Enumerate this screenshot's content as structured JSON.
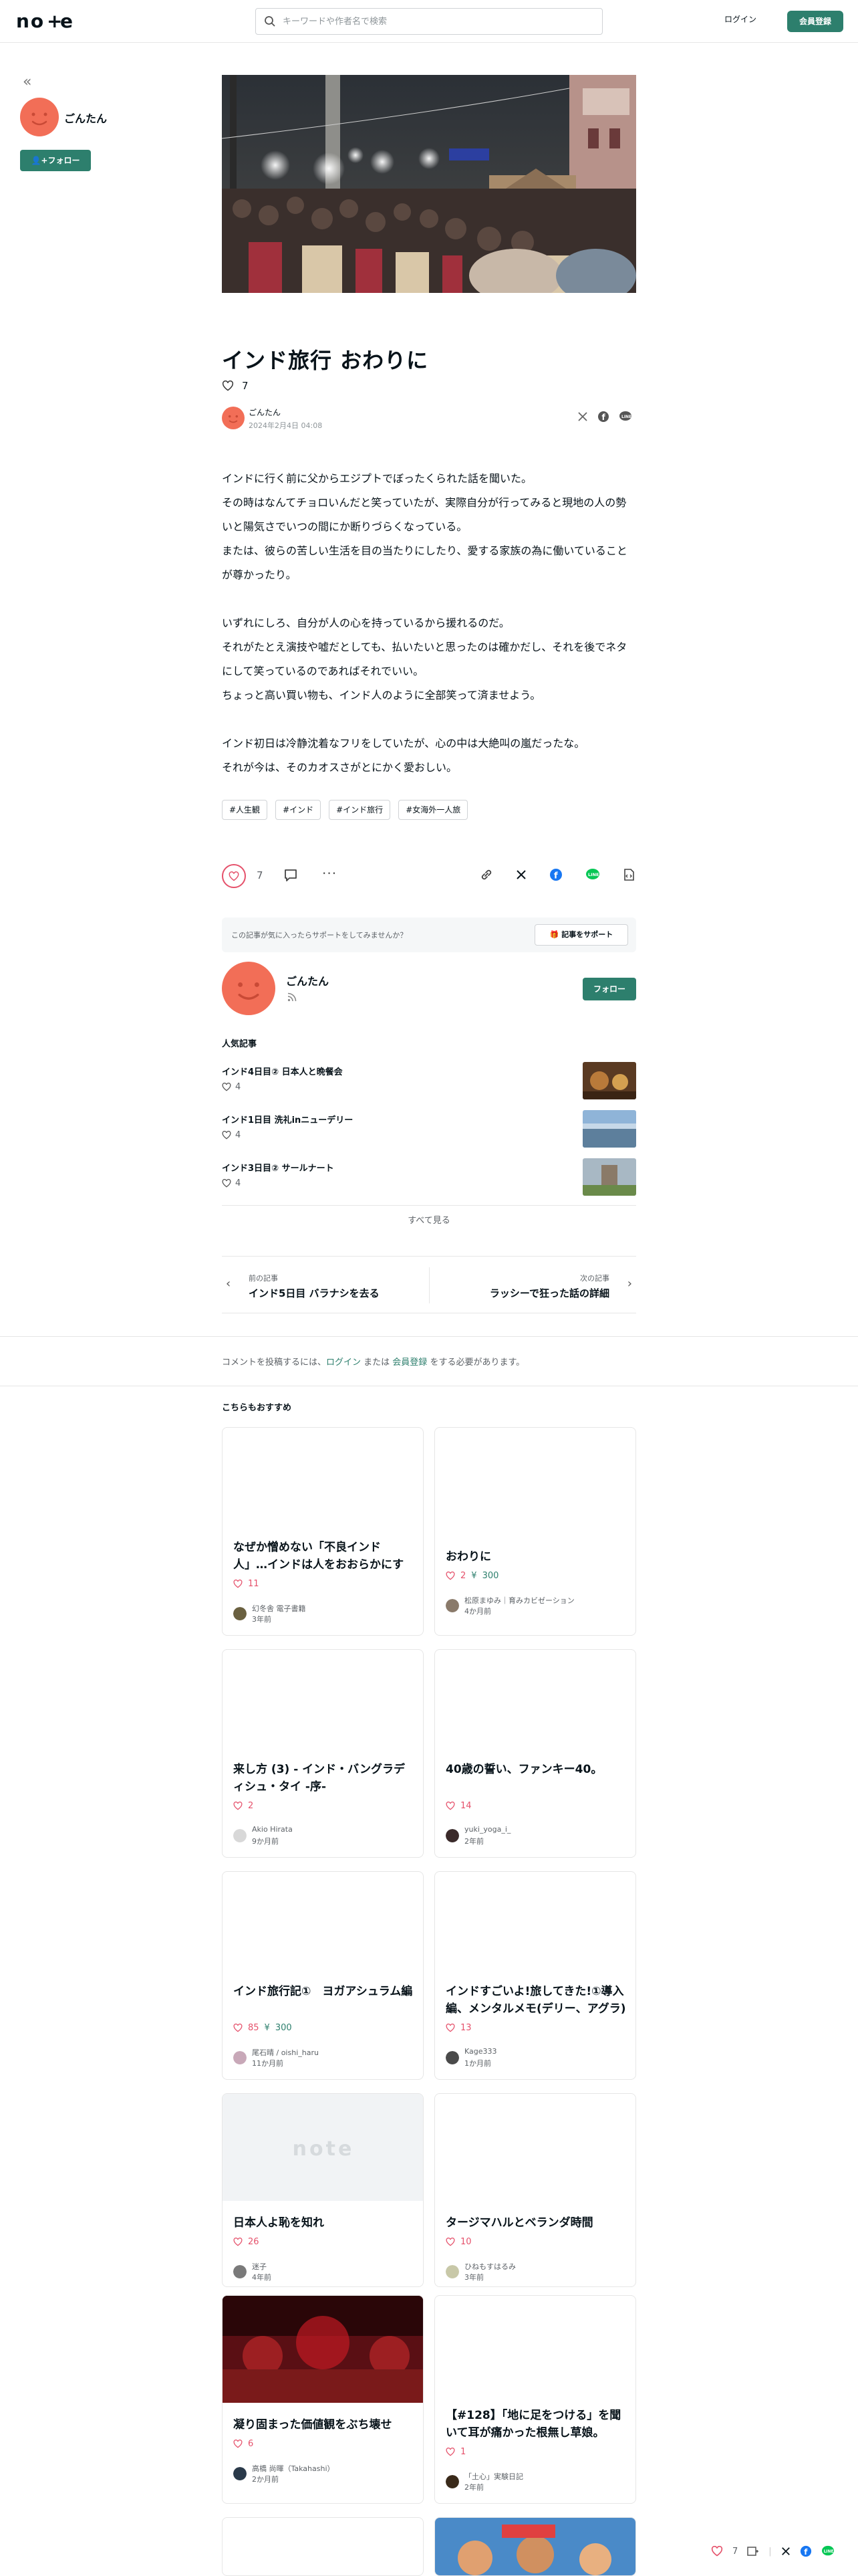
{
  "header": {
    "search_placeholder": "キーワードや作者名で検索",
    "login": "ログイン",
    "signup": "会員登録"
  },
  "sidebar": {
    "author_name": "ごんたん",
    "follow": "フォロー"
  },
  "article": {
    "title": "インド旅行 おわりに",
    "likes": "7",
    "author": "ごんたん",
    "date": "2024年2月4日 04:08",
    "paragraphs": [
      "インドに行く前に父からエジプトでぼったくられた話を聞いた。\nその時はなんてチョロいんだと笑っていたが、実際自分が行ってみると現地の人の勢いと陽気さでいつの間にか断りづらくなっている。\nまたは、彼らの苦しい生活を目の当たりにしたり、愛する家族の為に働いていることが尊かったり。",
      "いずれにしろ、自分が人の心を持っているから援れるのだ。\nそれがたとえ演技や嘘だとしても、払いたいと思ったのは確かだし、それを後でネタにして笑っているのであればそれでいい。\nちょっと高い買い物も、インド人のように全部笑って済ませよう。",
      "インド初日は冷静沈着なフリをしていたが、心の中は大絶叫の嵐だったな。\nそれが今は、そのカオスさがとにかく愛おしい。"
    ],
    "tags": [
      "#人生観",
      "#インド",
      "#インド旅行",
      "#女海外一人旅"
    ],
    "like_count": "7"
  },
  "support": {
    "text": "この記事が気に入ったらサポートをしてみませんか？",
    "button": "記事をサポート"
  },
  "creator_card": {
    "name": "ごんたん",
    "follow": "フォロー"
  },
  "popular": {
    "heading": "人気記事",
    "items": [
      {
        "title": "インド4日目② 日本人と晩餐会",
        "likes": "4"
      },
      {
        "title": "インド1日目 洗礼inニューデリー",
        "likes": "4"
      },
      {
        "title": "インド3日目② サールナート",
        "likes": "4"
      }
    ],
    "see_all": "すべて見る"
  },
  "prev_next": {
    "prev_label": "前の記事",
    "prev_title": "インド5日目 バラナシを去る",
    "next_label": "次の記事",
    "next_title": "ラッシーで狂った話の詳細"
  },
  "comment": {
    "prefix": "コメントを投稿するには、",
    "login": "ログイン",
    "middle": " または ",
    "signup": "会員登録",
    "suffix": " をする必要があります。"
  },
  "recommend": {
    "heading": "こちらもおすすめ",
    "cards": [
      {
        "title": "なぜか憎めない「不良インド人」…インドは人をおおらかにする",
        "likes": "11",
        "tips": "",
        "author": "幻冬舎 電子書籍",
        "date": "3年前"
      },
      {
        "title": "おわりに",
        "likes": "2",
        "tips": "300",
        "author": "松原まゆみ｜育みカビゼーション",
        "date": "4か月前"
      },
      {
        "title": "来し方 (3) - インド・バングラディシュ・タイ -序-",
        "likes": "2",
        "tips": "",
        "author": "Akio Hirata",
        "date": "9か月前"
      },
      {
        "title": "40歳の誓い、ファンキー40。",
        "likes": "14",
        "tips": "",
        "author": "yuki_yoga_i_",
        "date": "2年前"
      },
      {
        "title": "インド旅行記①　ヨガアシュラム編",
        "likes": "85",
        "tips": "300",
        "author": "尾石晴 / oishi_haru",
        "date": "11か月前"
      },
      {
        "title": "インドすごいよ!旅してきた!①導入編、メンタルメモ(デリー、アグラ)",
        "likes": "13",
        "tips": "",
        "author": "Kage333",
        "date": "1か月前"
      },
      {
        "title": "日本人よ恥を知れ",
        "likes": "26",
        "tips": "",
        "author": "迷子",
        "date": "4年前"
      },
      {
        "title": "タージマハルとベランダ時間",
        "likes": "10",
        "tips": "",
        "author": "ひねもすはるみ",
        "date": "3年前"
      },
      {
        "title": "凝り固まった価値観をぶち壊せ",
        "likes": "6",
        "tips": "",
        "author": "高橋 尚暉（Takahashi）",
        "date": "2か月前"
      },
      {
        "title": "【#128】「地に足をつける」を聞いて耳が痛かった根無し草娘。",
        "likes": "1",
        "tips": "",
        "author": "「土心」実験日記",
        "date": "2年前"
      }
    ]
  },
  "float_bar": {
    "likes": "7"
  },
  "colors": {
    "accent": "#2d7f6d",
    "like": "#e5516b",
    "avatar": "#f26e57"
  }
}
